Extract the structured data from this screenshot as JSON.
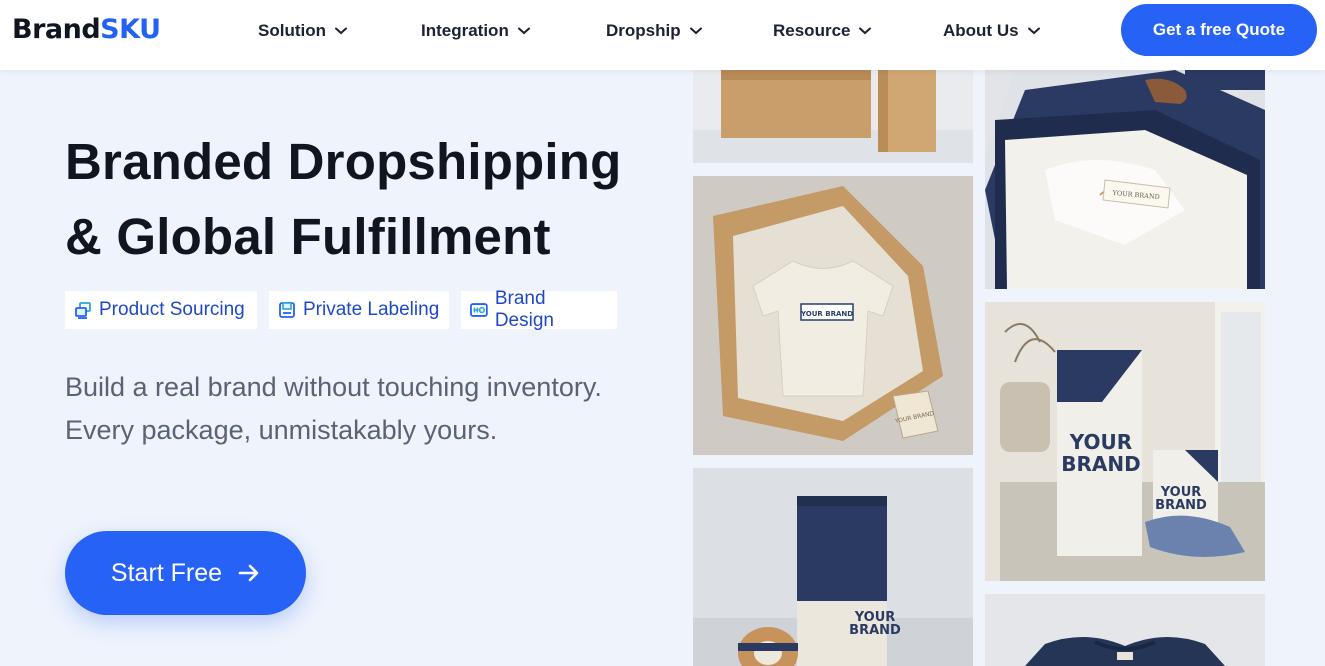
{
  "brand": {
    "part1": "Brand",
    "part2": "SKU"
  },
  "nav": [
    {
      "label": "Solution"
    },
    {
      "label": "Integration"
    },
    {
      "label": "Dropship"
    },
    {
      "label": "Resource"
    },
    {
      "label": "About Us"
    }
  ],
  "quote_button": "Get a free Quote",
  "hero": {
    "title_line1": "Branded Dropshipping",
    "title_line2": "& Global Fulfillment",
    "tags": [
      {
        "label": "Product Sourcing",
        "icon": "sourcing-icon"
      },
      {
        "label": "Private Labeling",
        "icon": "labeling-icon"
      },
      {
        "label": "Brand Design",
        "icon": "design-icon"
      }
    ],
    "sub_line1": "Build a real brand without touching inventory.",
    "sub_line2": "Every package, unmistakably yours.",
    "cta": "Start Free"
  },
  "images": {
    "tshirt_box_label": "YOUR BRAND",
    "tag_label": "YOUR BRAND",
    "tall_box_label_1": "YOUR",
    "tall_box_label_2": "BRAND",
    "small_box_label_1": "YOUR",
    "small_box_label_2": "BRAND",
    "bottom_box_label_1": "YOUR",
    "bottom_box_label_2": "BRAND"
  },
  "colors": {
    "accent": "#2762f6",
    "brand_blue": "#2462f5",
    "navy_box": "#2a3a63",
    "page_bg": "#eef3fc"
  }
}
